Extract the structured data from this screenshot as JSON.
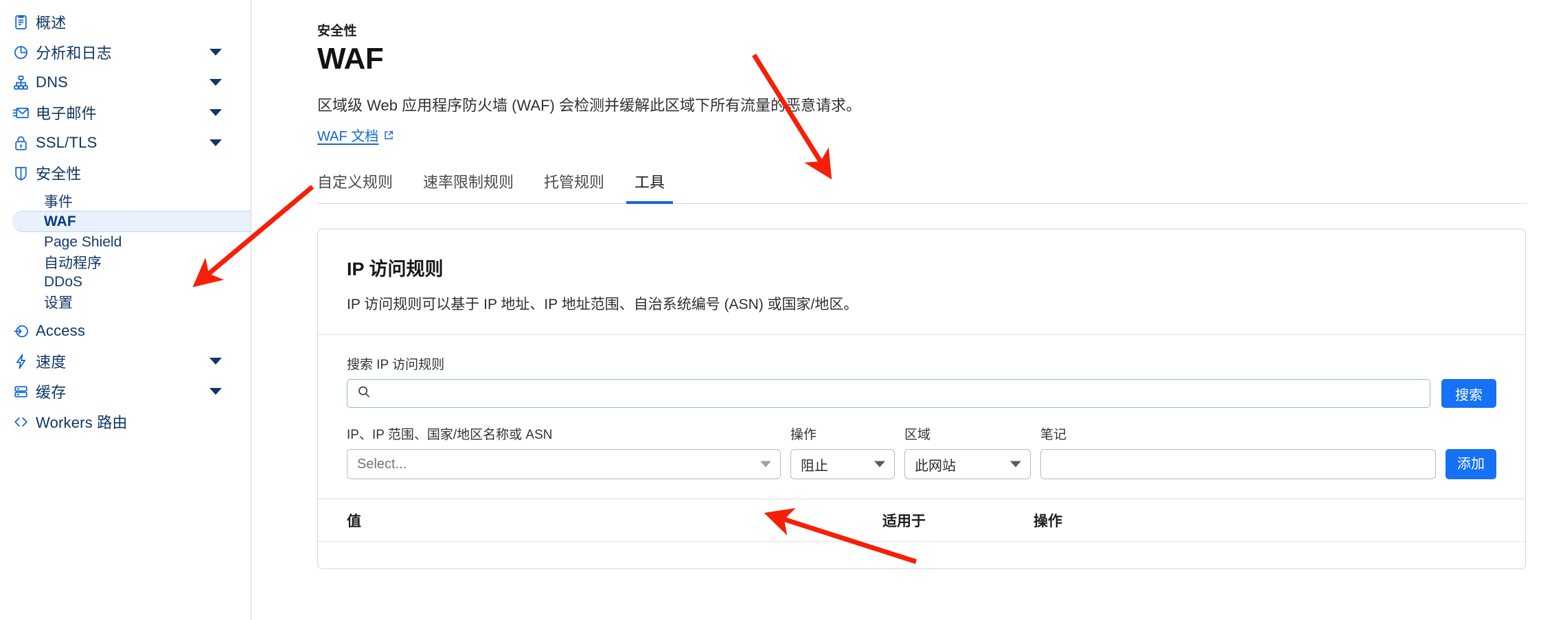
{
  "sidebar": {
    "items": [
      {
        "label": "概述",
        "icon": "clipboard-icon",
        "expandable": false
      },
      {
        "label": "分析和日志",
        "icon": "analytics-pie-icon",
        "expandable": true
      },
      {
        "label": "DNS",
        "icon": "dns-tree-icon",
        "expandable": true
      },
      {
        "label": "电子邮件",
        "icon": "email-icon",
        "expandable": true
      },
      {
        "label": "SSL/TLS",
        "icon": "lock-icon",
        "expandable": true
      },
      {
        "label": "安全性",
        "icon": "shield-icon",
        "expandable": false
      }
    ],
    "security_children": [
      {
        "label": "事件",
        "active": false
      },
      {
        "label": "WAF",
        "active": true
      },
      {
        "label": "Page Shield",
        "active": false
      },
      {
        "label": "自动程序",
        "active": false
      },
      {
        "label": "DDoS",
        "active": false
      },
      {
        "label": "设置",
        "active": false
      }
    ],
    "items_after": [
      {
        "label": "Access",
        "icon": "access-arrow-icon",
        "expandable": false
      },
      {
        "label": "速度",
        "icon": "speed-bolt-icon",
        "expandable": true
      },
      {
        "label": "缓存",
        "icon": "cache-database-icon",
        "expandable": true
      },
      {
        "label": "Workers 路由",
        "icon": "workers-code-icon",
        "expandable": false
      }
    ]
  },
  "header": {
    "eyebrow": "安全性",
    "title": "WAF",
    "description": "区域级 Web 应用程序防火墙 (WAF) 会检测并缓解此区域下所有流量的恶意请求。",
    "doc_link": "WAF 文档",
    "doc_link_icon": "external-link-icon"
  },
  "tabs": [
    {
      "label": "自定义规则",
      "active": false
    },
    {
      "label": "速率限制规则",
      "active": false
    },
    {
      "label": "托管规则",
      "active": false
    },
    {
      "label": "工具",
      "active": true
    }
  ],
  "card": {
    "title": "IP 访问规则",
    "subtitle": "IP 访问规则可以基于 IP 地址、IP 地址范围、自治系统编号 (ASN) 或国家/地区。",
    "search": {
      "label": "搜索 IP 访问规则",
      "value": "",
      "placeholder": "",
      "icon": "search-icon",
      "button_label": "搜索"
    },
    "add_form": {
      "value_label": "IP、IP 范围、国家/地区名称或 ASN",
      "value_placeholder": "Select...",
      "action_label": "操作",
      "action_value": "阻止",
      "zone_label": "区域",
      "zone_value": "此网站",
      "note_label": "笔记",
      "note_value": "",
      "add_button_label": "添加"
    },
    "table": {
      "columns": [
        "值",
        "适用于",
        "操作"
      ],
      "rows": []
    }
  },
  "colors": {
    "accent_blue": "#1571f5",
    "nav_blue": "#0f3562",
    "icon_blue": "#1366d6",
    "active_bg": "#e9f1fd",
    "annotation_red": "#f61f08"
  }
}
